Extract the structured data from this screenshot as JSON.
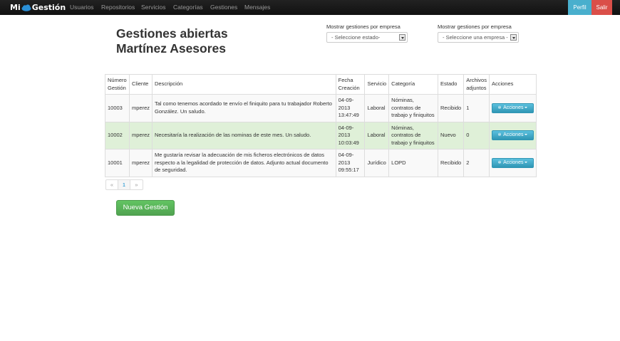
{
  "navbar": {
    "brand_left": "Mi",
    "brand_right": "Gestión",
    "items": [
      "Usuarios",
      "Repositorios",
      "Servicios",
      "Categorías",
      "Gestiones",
      "Mensajes"
    ],
    "perfil": "Perfil",
    "salir": "Salir"
  },
  "page": {
    "title_line1": "Gestiones abiertas",
    "title_line2": "Martínez Asesores"
  },
  "filters": {
    "estado": {
      "label": "Mostrar gestiones por empresa",
      "value": "- Seleccione estado-"
    },
    "empresa": {
      "label": "Mostrar gestiones por empresa",
      "value": "- Seleccione una empresa -"
    }
  },
  "table": {
    "headers": {
      "numero_1": "Número",
      "numero_2": "Gestión",
      "cliente": "Cliente",
      "descripcion": "Descripción",
      "fecha_1": "Fecha",
      "fecha_2": "Creación",
      "servicio": "Servicio",
      "categoria": "Categoría",
      "estado": "Estado",
      "archivos_1": "Archivos",
      "archivos_2": "adjuntos",
      "acciones": "Acciones"
    },
    "rows": [
      {
        "numero": "10003",
        "cliente": "mperez",
        "descripcion": "Tal como tenemos acordado te envío el finiquito para tu trabajador Roberto González. Un saludo.",
        "fecha_1": "04-09-",
        "fecha_2": "2013",
        "fecha_3": "13:47:49",
        "servicio": "Laboral",
        "categoria": "Nóminas, contratos de trabajo y finiquitos",
        "estado": "Recibido",
        "archivos": "1",
        "accion": "Acciones"
      },
      {
        "numero": "10002",
        "cliente": "mperez",
        "descripcion": "Necesitaría la realización de las nominas de este mes. Un saludo.",
        "fecha_1": "04-09-",
        "fecha_2": "2013",
        "fecha_3": "10:03:49",
        "servicio": "Laboral",
        "categoria": "Nóminas, contratos de trabajo y finiquitos",
        "estado": "Nuevo",
        "archivos": "0",
        "accion": "Acciones"
      },
      {
        "numero": "10001",
        "cliente": "mperez",
        "descripcion": "Me gustaría revisar la adecuación de mis ficheros electrónicos de datos respecto a la legalidad de protección de datos. Adjunto actual documento de seguridad.",
        "fecha_1": "04-09-",
        "fecha_2": "2013",
        "fecha_3": "09:55:17",
        "servicio": "Jurídico",
        "categoria": "LOPD",
        "estado": "Recibido",
        "archivos": "2",
        "accion": "Acciones"
      }
    ]
  },
  "pagination": {
    "prev": "«",
    "current": "1",
    "next": "»"
  },
  "new_button": "Nueva Gestión",
  "colors": {
    "navbar": "#1b1b1b",
    "info": "#49afcd",
    "danger": "#da4f49",
    "success": "#51a351",
    "row_success": "#dff0d8"
  }
}
